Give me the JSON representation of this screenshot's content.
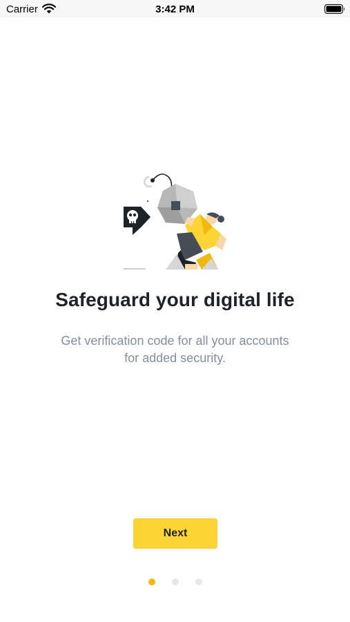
{
  "status_bar": {
    "carrier": "Carrier",
    "time": "3:42 PM",
    "wifi_icon": "wifi-icon",
    "battery_icon": "battery-full-icon"
  },
  "onboarding": {
    "illustration_icon": "security-lock-illustration",
    "title": "Safeguard your digital life",
    "subtitle_line1": "Get verification code for all your accounts",
    "subtitle_line2": "for added security.",
    "next_label": "Next",
    "page_indicator": {
      "total": 3,
      "active": 1
    }
  },
  "colors": {
    "primary_button": "#fcd535",
    "active_dot": "#f0b90b",
    "inactive_dot": "#e6e8ea",
    "title": "#1e2329",
    "subtitle": "#848e9c"
  }
}
